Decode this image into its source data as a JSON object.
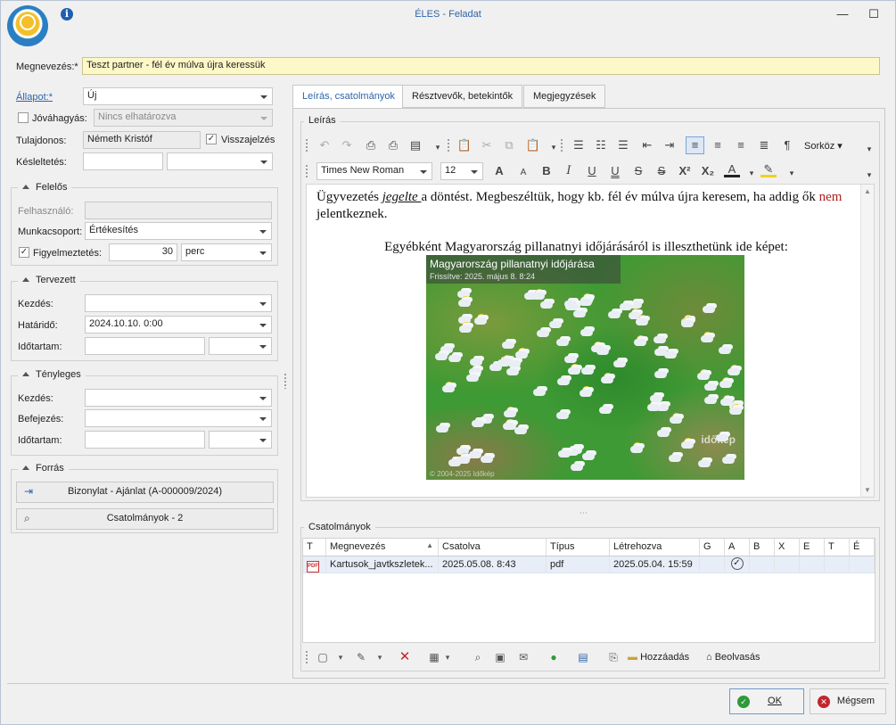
{
  "window": {
    "title": "ÉLES - Feladat",
    "minimize_glyph": "—",
    "maximize_glyph": "☐",
    "close_glyph": "✕",
    "info_glyph": "i"
  },
  "header": {
    "name_label": "Megnevezés:*",
    "name_value": "Teszt partner - fél év múlva újra keressük"
  },
  "left": {
    "status_label": "Állapot:*",
    "status_value": "Új",
    "approval_label": "Jóváhagyás:",
    "approval_value": "Nincs elhatározva",
    "owner_label": "Tulajdonos:",
    "owner_value": "Németh Kristóf",
    "feedback_label": "Visszajelzés",
    "delay_label": "Késleltetés:",
    "responsible": {
      "title": "Felelős",
      "user_label": "Felhasználó:",
      "workgroup_label": "Munkacsoport:",
      "workgroup_value": "Értékesítés",
      "alert_label": "Figyelmeztetés:",
      "alert_value": "30",
      "alert_unit": "perc"
    },
    "planned": {
      "title": "Tervezett",
      "start_label": "Kezdés:",
      "deadline_label": "Határidő:",
      "deadline_value": "2024.10.10. 0:00",
      "duration_label": "Időtartam:"
    },
    "actual": {
      "title": "Tényleges",
      "start_label": "Kezdés:",
      "end_label": "Befejezés:",
      "duration_label": "Időtartam:"
    },
    "source": {
      "title": "Forrás",
      "doc_button": "Bizonylat - Ajánlat (A-000009/2024)",
      "attach_button": "Csatolmányok - 2"
    }
  },
  "tabs": [
    {
      "label": "Leírás, csatolmányok"
    },
    {
      "label": "Résztvevők, betekintők"
    },
    {
      "label": "Megjegyzések"
    }
  ],
  "editor": {
    "group_title": "Leírás",
    "line_spacing_label": "Sorköz",
    "font_name": "Times New Roman",
    "font_size": "12",
    "text_part1": "Ügyvezetés ",
    "text_emph": "jegelte ",
    "text_part2": "a döntést. Megbeszéltük, hogy kb. fél év múlva újra keresem, ha addig ők ",
    "text_red": "nem",
    "text_part3": " jelentkeznek.",
    "text_line2": "Egyébként Magyarország pillanatnyi időjárásáról is illeszthetünk ide képet:",
    "image_title": "Magyarország pillanatnyi időjárása",
    "image_subtitle": "Frissítve: 2025. május 8. 8:24",
    "image_watermark": "időkép",
    "image_footer": "© 2004-2025 Időkép"
  },
  "attachments": {
    "group_title": "Csatolmányok",
    "columns": [
      "T",
      "Megnevezés",
      "Csatolva",
      "Típus",
      "Létrehozva",
      "G",
      "A",
      "B",
      "X",
      "E",
      "T",
      "É"
    ],
    "rows": [
      {
        "icon": "PDF",
        "name": "Kartusok_javtkszletek...",
        "attached": "2025.05.08. 8:43",
        "type": "pdf",
        "created": "2025.05.04. 15:59"
      }
    ],
    "add_label": "Hozzáadás",
    "scan_label": "Beolvasás"
  },
  "footer": {
    "ok_label": "OK",
    "cancel_label": "Mégsem"
  }
}
